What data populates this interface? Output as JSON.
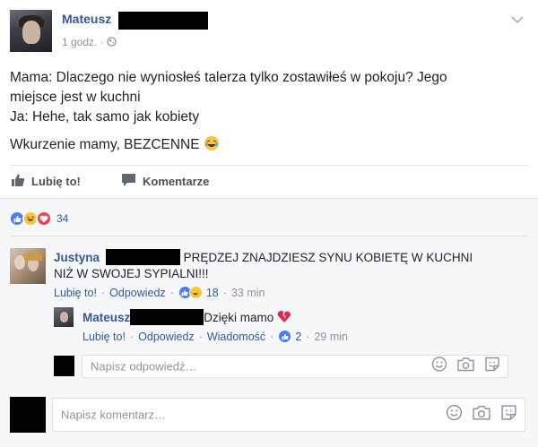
{
  "post": {
    "author_name": "Mateusz",
    "time": "1 godz.",
    "meta_separator": "·",
    "lines": [
      "Mama: Dlaczego nie wyniosłeś talerza tylko zostawiłeś w pokoju? Jego",
      "miejsce jest w kuchni",
      "Ja: Hehe, tak samo jak kobiety"
    ],
    "tagline": "Wkurzenie mamy, BEZCENNE"
  },
  "actions": {
    "like_label": "Lubię to!",
    "comment_label": "Komentarze"
  },
  "reactions": {
    "count": "34"
  },
  "comments": [
    {
      "author": "Justyna",
      "text_line1": "PRĘDZEJ ZNAJDZIESZ SYNU KOBIETĘ W KUCHNI",
      "text_line2": "NIŻ W SWOJEJ SYPIALNI!!!",
      "like": "Lubię to!",
      "reply": "Odpowiedz",
      "reaction_count": "18",
      "time": "33 min"
    }
  ],
  "reply": {
    "author": "Mateusz",
    "text": "Dzięki mamo",
    "like": "Lubię to!",
    "reply": "Odpowiedz",
    "message": "Wiadomość",
    "reaction_count": "2",
    "time": "29 min"
  },
  "inputs": {
    "reply_placeholder": "Napisz odpowiedź…",
    "comment_placeholder": "Napisz komentarz…"
  },
  "colors": {
    "link": "#365899",
    "like_blue": "#4a7ef0",
    "haha_yellow": "#f7c640",
    "love_red": "#f33e58"
  }
}
